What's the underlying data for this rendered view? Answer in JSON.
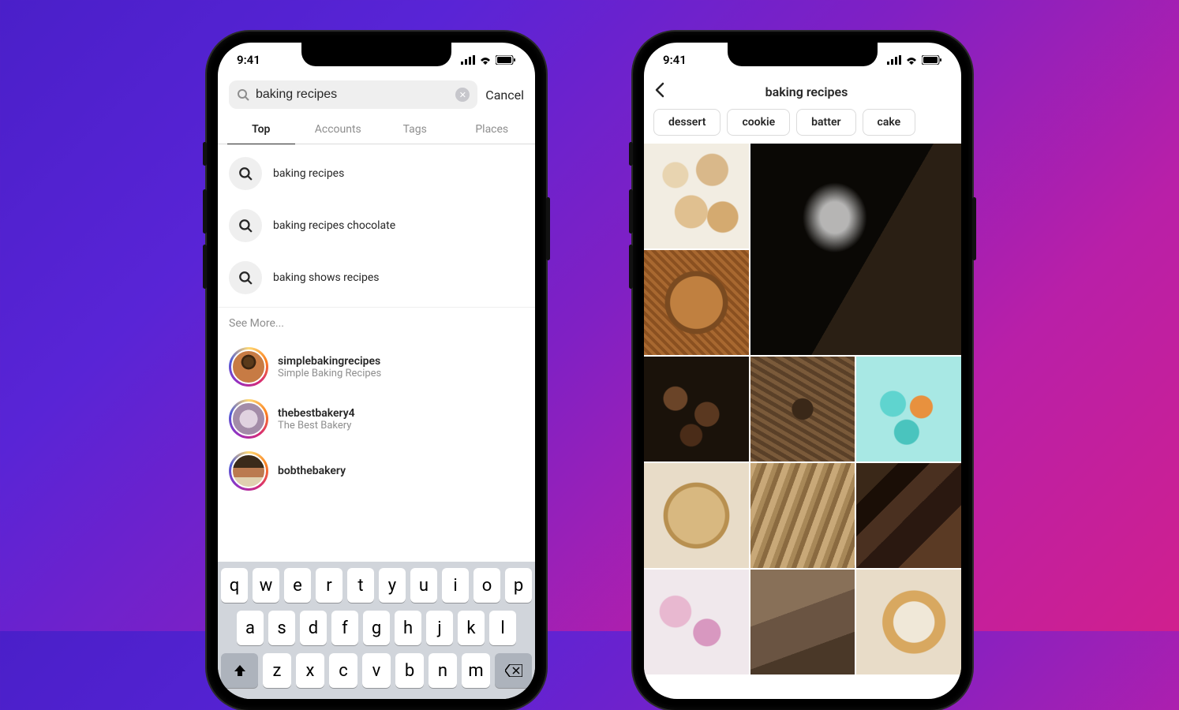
{
  "status": {
    "time": "9:41"
  },
  "search": {
    "query": "baking recipes",
    "cancel": "Cancel",
    "tabs": [
      "Top",
      "Accounts",
      "Tags",
      "Places"
    ],
    "suggestions": [
      "baking recipes",
      "baking recipes chocolate",
      "baking shows recipes"
    ],
    "see_more": "See More...",
    "accounts": [
      {
        "username": "simplebakingrecipes",
        "display": "Simple Baking Recipes"
      },
      {
        "username": "thebestbakery4",
        "display": "The Best Bakery"
      },
      {
        "username": "bobthebakery",
        "display": ""
      }
    ],
    "keyboard": {
      "row1": [
        "q",
        "w",
        "e",
        "r",
        "t",
        "y",
        "u",
        "i",
        "o",
        "p"
      ],
      "row2": [
        "a",
        "s",
        "d",
        "f",
        "g",
        "h",
        "j",
        "k",
        "l"
      ],
      "row3": [
        "z",
        "x",
        "c",
        "v",
        "b",
        "n",
        "m"
      ]
    }
  },
  "results": {
    "title": "baking recipes",
    "chips": [
      "dessert",
      "cookie",
      "batter",
      "cake"
    ]
  }
}
